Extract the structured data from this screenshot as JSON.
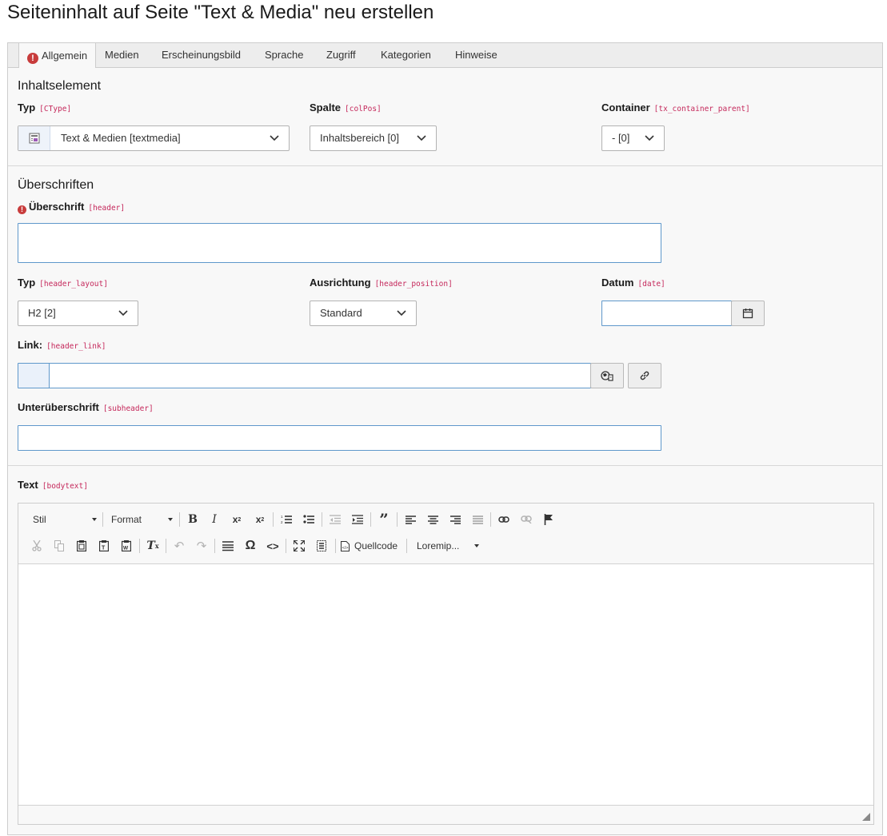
{
  "page": {
    "title": "Seiteninhalt auf Seite \"Text & Media\" neu erstellen"
  },
  "tabs": [
    {
      "label": "Allgemein",
      "active": true,
      "error": true
    },
    {
      "label": "Medien"
    },
    {
      "label": "Erscheinungsbild"
    },
    {
      "label": "Sprache"
    },
    {
      "label": "Zugriff"
    },
    {
      "label": "Kategorien"
    },
    {
      "label": "Hinweise"
    }
  ],
  "content_element": {
    "title": "Inhaltselement",
    "type": {
      "label": "Typ",
      "field": "[CType]",
      "value": "Text & Medien [textmedia]"
    },
    "column": {
      "label": "Spalte",
      "field": "[colPos]",
      "value": "Inhaltsbereich [0]"
    },
    "container": {
      "label": "Container",
      "field": "[tx_container_parent]",
      "value": "- [0]"
    }
  },
  "headlines": {
    "title": "Überschriften",
    "header": {
      "label": "Überschrift",
      "field": "[header]",
      "value": "",
      "required_error": true
    },
    "layout": {
      "label": "Typ",
      "field": "[header_layout]",
      "value": "H2 [2]"
    },
    "position": {
      "label": "Ausrichtung",
      "field": "[header_position]",
      "value": "Standard"
    },
    "date": {
      "label": "Datum",
      "field": "[date]",
      "value": ""
    },
    "link": {
      "label": "Link:",
      "field": "[header_link]",
      "value": ""
    },
    "subheader": {
      "label": "Unterüberschrift",
      "field": "[subheader]",
      "value": ""
    }
  },
  "bodytext": {
    "label": "Text",
    "field": "[bodytext]",
    "toolbar": {
      "style_combo": "Stil",
      "format_combo": "Format",
      "source_label": "Quellcode",
      "lorem_combo": "Loremip..."
    },
    "content": ""
  },
  "colors": {
    "accent_code": "#c5285b",
    "error": "#c83c3c",
    "input_border": "#5f98cb"
  }
}
